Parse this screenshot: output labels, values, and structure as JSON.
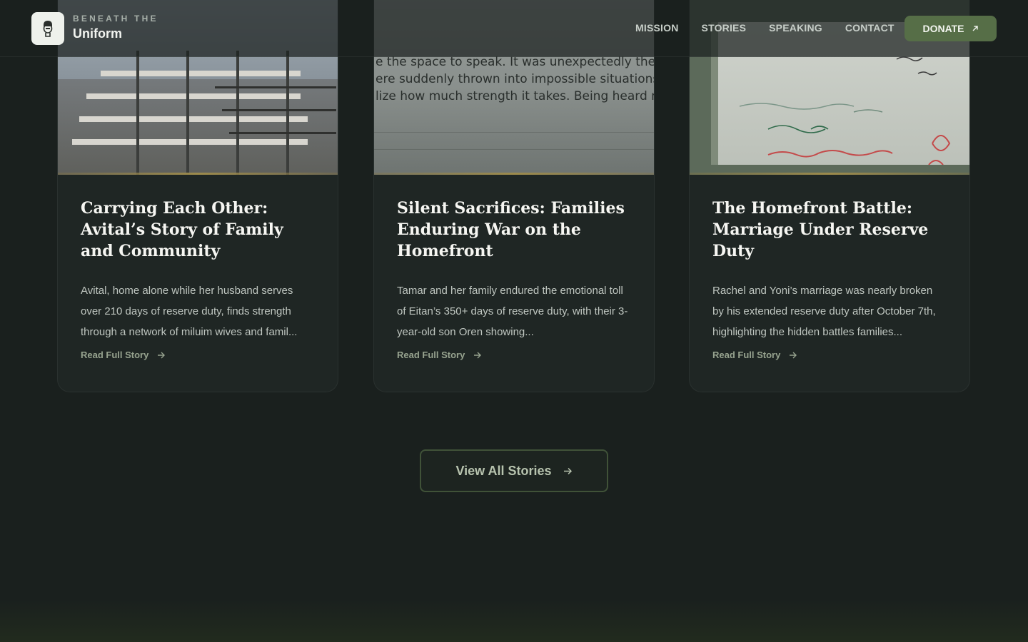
{
  "brand": {
    "top": "BENEATH THE",
    "main": "Uniform"
  },
  "nav": {
    "items": [
      "MISSION",
      "STORIES",
      "SPEAKING",
      "CONTACT"
    ],
    "donate_label": "DONATE"
  },
  "stories": [
    {
      "title": "Carrying Each Other: Avital’s Story of Family and Community",
      "excerpt": "Avital, home alone while her husband serves over 210 days of reserve duty, finds strength through a network of miluim wives and famil...",
      "read_more": "Read Full Story"
    },
    {
      "title": "Silent Sacrifices: Families Enduring War on the Homefront",
      "excerpt": "Tamar and her family endured the emotional toll of Eitan’s 350+ days of reserve duty, with their 3-year-old son Oren showing...",
      "read_more": "Read Full Story",
      "image_text": [
        "e the space to speak. It was unexpectedly therape",
        "ere suddenly thrown into impossible situations, an",
        "lize how much strength it takes. Being heard matte"
      ]
    },
    {
      "title": "The Homefront Battle: Marriage Under Reserve Duty",
      "excerpt": "Rachel and Yoni’s marriage was nearly broken by his extended reserve duty after October 7th, highlighting the hidden battles families...",
      "read_more": "Read Full Story"
    }
  ],
  "view_all_label": "View All Stories",
  "colors": {
    "background": "#1a201e",
    "card": "#1f2624",
    "accent_green": "#566e47",
    "gold_line": "#9c8a4c"
  }
}
